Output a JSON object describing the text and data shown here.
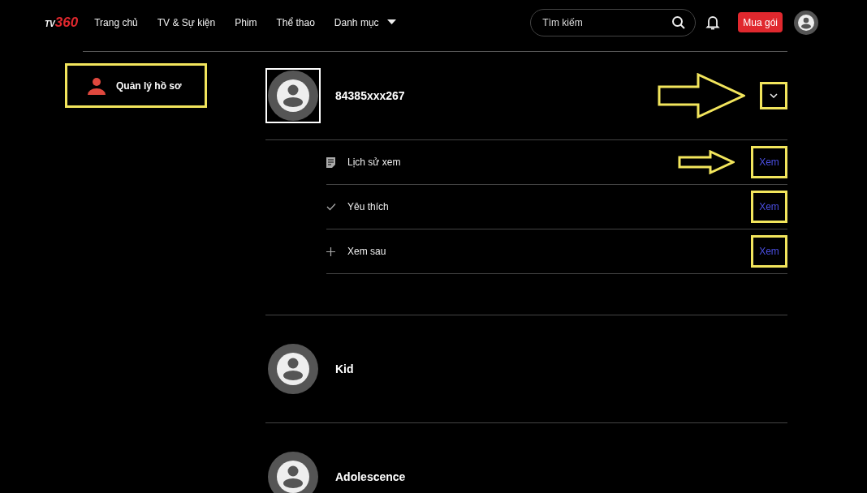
{
  "nav": {
    "logo_prefix": "TV",
    "logo_main": "360",
    "links": [
      {
        "label": "Trang chủ"
      },
      {
        "label": "TV & Sự kiện"
      },
      {
        "label": "Phim"
      },
      {
        "label": "Thể thao"
      },
      {
        "label": "Danh mục",
        "dropdown": true
      }
    ],
    "search": {
      "placeholder": "Tìm kiếm"
    },
    "buy_button": "Mua gói"
  },
  "sidebar": {
    "items": [
      {
        "label": "Quản lý hồ sơ",
        "selected": true,
        "highlighted": true
      }
    ]
  },
  "profiles": [
    {
      "name": "84385xxx267",
      "expanded": true,
      "highlighted": true,
      "arrow": true,
      "items": [
        {
          "kind": "history",
          "label": "Lịch sử xem",
          "action": "Xem",
          "highlighted": true,
          "arrow": true
        },
        {
          "kind": "favorite",
          "label": "Yêu thích",
          "action": "Xem",
          "highlighted": true,
          "arrow": false
        },
        {
          "kind": "later",
          "label": "Xem sau",
          "action": "Xem",
          "highlighted": true,
          "arrow": false
        }
      ]
    },
    {
      "name": "Kid",
      "expanded": false,
      "highlighted": false
    },
    {
      "name": "Adolescence",
      "expanded": false,
      "highlighted": false
    }
  ]
}
